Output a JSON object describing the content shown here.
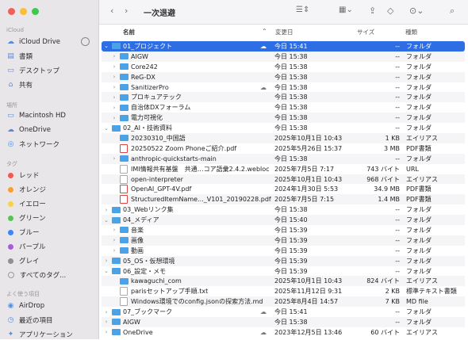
{
  "window": {
    "title": "一次退避"
  },
  "sidebar": {
    "sections": [
      "iCloud",
      "場所",
      "タグ",
      "よく使う項目"
    ],
    "icloud": [
      {
        "label": "iCloud Drive",
        "icon": "cloud-icon"
      },
      {
        "label": "書類",
        "icon": "doc-icon"
      },
      {
        "label": "デスクトップ",
        "icon": "desktop-icon"
      },
      {
        "label": "共有",
        "icon": "shared-folder-icon"
      }
    ],
    "places": [
      {
        "label": "Macintosh HD",
        "icon": "disk-icon"
      },
      {
        "label": "OneDrive",
        "icon": "cloud-icon"
      },
      {
        "label": "ネットワーク",
        "icon": "network-icon"
      }
    ],
    "tags": [
      {
        "label": "レッド",
        "color": "#f05a4f"
      },
      {
        "label": "オレンジ",
        "color": "#f5a030"
      },
      {
        "label": "イエロー",
        "color": "#f5d24a"
      },
      {
        "label": "グリーン",
        "color": "#57c353"
      },
      {
        "label": "ブルー",
        "color": "#3d84f7"
      },
      {
        "label": "パープル",
        "color": "#a55fd4"
      },
      {
        "label": "グレイ",
        "color": "#8e8e93"
      },
      {
        "label": "すべてのタグ...",
        "color": ""
      }
    ],
    "favorites": [
      {
        "label": "AirDrop",
        "icon": "airdrop-icon"
      },
      {
        "label": "最近の項目",
        "icon": "clock-icon"
      },
      {
        "label": "アプリケーション",
        "icon": "apps-icon"
      }
    ]
  },
  "columns": {
    "name": "名前",
    "date": "変更日",
    "size": "サイズ",
    "kind": "種類"
  },
  "rows": [
    {
      "lvl": 0,
      "chev": "v",
      "t": "folder",
      "name": "01_プロジェクト",
      "cloud": true,
      "date": "今日 15:41",
      "size": "--",
      "kind": "フォルダ",
      "sel": true
    },
    {
      "lvl": 1,
      "chev": ">",
      "t": "folder",
      "name": "AIGW",
      "cloud": false,
      "date": "今日 15:38",
      "size": "--",
      "kind": "フォルダ"
    },
    {
      "lvl": 1,
      "chev": ">",
      "t": "folder",
      "name": "Core242",
      "cloud": false,
      "date": "今日 15:38",
      "size": "--",
      "kind": "フォルダ"
    },
    {
      "lvl": 1,
      "chev": ">",
      "t": "folder",
      "name": "ReG-DX",
      "cloud": false,
      "date": "今日 15:38",
      "size": "--",
      "kind": "フォルダ"
    },
    {
      "lvl": 1,
      "chev": ">",
      "t": "folder",
      "name": "SanitizerPro",
      "cloud": true,
      "date": "今日 15:38",
      "size": "--",
      "kind": "フォルダ"
    },
    {
      "lvl": 1,
      "chev": ">",
      "t": "folder",
      "name": "プロキュアテック",
      "cloud": false,
      "date": "今日 15:38",
      "size": "--",
      "kind": "フォルダ"
    },
    {
      "lvl": 1,
      "chev": ">",
      "t": "folder",
      "name": "自治体DXフォーラム",
      "cloud": false,
      "date": "今日 15:38",
      "size": "--",
      "kind": "フォルダ"
    },
    {
      "lvl": 1,
      "chev": ">",
      "t": "folder",
      "name": "電力可視化",
      "cloud": false,
      "date": "今日 15:38",
      "size": "--",
      "kind": "フォルダ"
    },
    {
      "lvl": 0,
      "chev": "v",
      "t": "folder",
      "name": "02_AI・技術資料",
      "cloud": false,
      "date": "今日 15:38",
      "size": "--",
      "kind": "フォルダ"
    },
    {
      "lvl": 1,
      "chev": "",
      "t": "folder",
      "name": "20230310_中国語",
      "cloud": false,
      "date": "2025年10月1日 10:43",
      "size": "1 KB",
      "kind": "エイリアス"
    },
    {
      "lvl": 1,
      "chev": "",
      "t": "pdf",
      "name": "20250522 Zoom Phoneご紹介.pdf",
      "cloud": false,
      "date": "2025年5月26日 15:37",
      "size": "3 MB",
      "kind": "PDF書類"
    },
    {
      "lvl": 1,
      "chev": ">",
      "t": "folder",
      "name": "anthropic-quickstarts-main",
      "cloud": false,
      "date": "今日 15:38",
      "size": "--",
      "kind": "フォルダ"
    },
    {
      "lvl": 1,
      "chev": "",
      "t": "file",
      "name": "IMI情報共有基盤　共通…コア語彙2.4.2.webloc",
      "cloud": false,
      "date": "2025年7月5日 7:17",
      "size": "743 バイト",
      "kind": "URL"
    },
    {
      "lvl": 1,
      "chev": "",
      "t": "file",
      "name": "open-interpreter",
      "cloud": false,
      "date": "2025年10月1日 10:43",
      "size": "968 バイト",
      "kind": "エイリアス"
    },
    {
      "lvl": 1,
      "chev": "",
      "t": "pdf",
      "name": "OpenAI_GPT-4V.pdf",
      "cloud": false,
      "date": "2024年1月30日 5:53",
      "size": "34.9 MB",
      "kind": "PDF書類"
    },
    {
      "lvl": 1,
      "chev": "",
      "t": "pdf",
      "name": "StructuredItemName..._V101_20190228.pdf",
      "cloud": false,
      "date": "2025年7月5日 7:15",
      "size": "1.4 MB",
      "kind": "PDF書類"
    },
    {
      "lvl": 0,
      "chev": ">",
      "t": "folder",
      "name": "03_Webリンク集",
      "cloud": false,
      "date": "今日 15:38",
      "size": "--",
      "kind": "フォルダ"
    },
    {
      "lvl": 0,
      "chev": "v",
      "t": "folder",
      "name": "04_メディア",
      "cloud": false,
      "date": "今日 15:40",
      "size": "--",
      "kind": "フォルダ"
    },
    {
      "lvl": 1,
      "chev": ">",
      "t": "folder",
      "name": "音楽",
      "cloud": false,
      "date": "今日 15:39",
      "size": "--",
      "kind": "フォルダ"
    },
    {
      "lvl": 1,
      "chev": ">",
      "t": "folder",
      "name": "画像",
      "cloud": false,
      "date": "今日 15:39",
      "size": "--",
      "kind": "フォルダ"
    },
    {
      "lvl": 1,
      "chev": ">",
      "t": "folder",
      "name": "動画",
      "cloud": false,
      "date": "今日 15:39",
      "size": "--",
      "kind": "フォルダ"
    },
    {
      "lvl": 0,
      "chev": ">",
      "t": "folder",
      "name": "05_OS・仮想環境",
      "cloud": false,
      "date": "今日 15:39",
      "size": "--",
      "kind": "フォルダ"
    },
    {
      "lvl": 0,
      "chev": "v",
      "t": "folder",
      "name": "06_設定・メモ",
      "cloud": false,
      "date": "今日 15:39",
      "size": "--",
      "kind": "フォルダ"
    },
    {
      "lvl": 1,
      "chev": "",
      "t": "folder",
      "name": "kawaguchi_com",
      "cloud": false,
      "date": "2025年10月1日 10:43",
      "size": "824 バイト",
      "kind": "エイリアス"
    },
    {
      "lvl": 1,
      "chev": "",
      "t": "file",
      "name": "parisセットアップ手順.txt",
      "cloud": false,
      "date": "2025年11月12日 9:31",
      "size": "2 KB",
      "kind": "標準テキスト書類"
    },
    {
      "lvl": 1,
      "chev": "",
      "t": "file",
      "name": "Windows環境でのconfig.jsonの探索方法.md",
      "cloud": false,
      "date": "2025年8月4日 14:57",
      "size": "7 KB",
      "kind": "MD file"
    },
    {
      "lvl": 0,
      "chev": ">",
      "t": "folder",
      "name": "07_ブックマーク",
      "cloud": true,
      "date": "今日 15:41",
      "size": "--",
      "kind": "フォルダ"
    },
    {
      "lvl": 0,
      "chev": ">",
      "t": "folder",
      "name": "AIGW",
      "cloud": false,
      "date": "今日 15:38",
      "size": "--",
      "kind": "フォルダ"
    },
    {
      "lvl": 0,
      "chev": ">",
      "t": "folder",
      "name": "OneDrive",
      "cloud": true,
      "date": "2023年12月5日 13:46",
      "size": "60 バイト",
      "kind": "エイリアス"
    }
  ]
}
